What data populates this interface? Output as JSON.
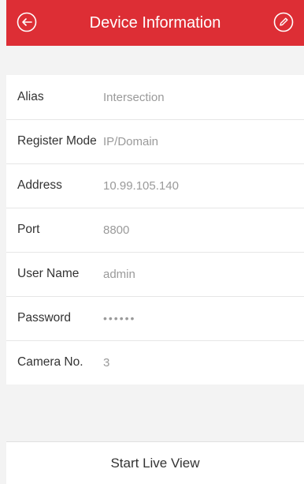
{
  "header": {
    "title": "Device Information",
    "back_icon": "back-arrow-circle-icon",
    "edit_icon": "pencil-circle-icon",
    "background_color": "#dd2e35"
  },
  "fields": [
    {
      "label": "Alias",
      "value": "Intersection"
    },
    {
      "label": "Register Mode",
      "value": "IP/Domain"
    },
    {
      "label": "Address",
      "value": "10.99.105.140"
    },
    {
      "label": "Port",
      "value": "8800"
    },
    {
      "label": "User Name",
      "value": "admin"
    },
    {
      "label": "Password",
      "value": "••••••"
    },
    {
      "label": "Camera No.",
      "value": "3"
    }
  ],
  "footer": {
    "button_label": "Start Live View"
  }
}
